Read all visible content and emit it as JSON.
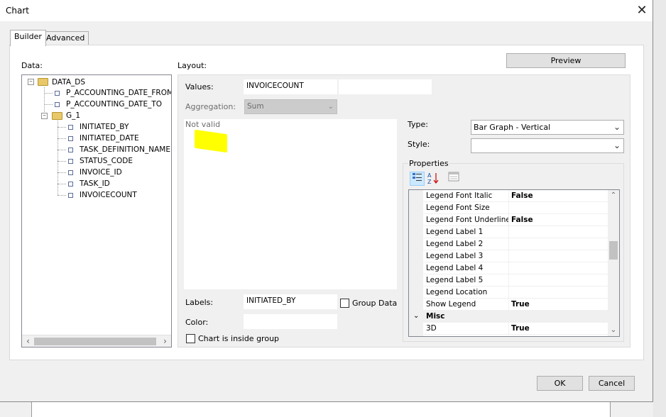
{
  "window": {
    "title": "Chart",
    "close_icon": "close-icon"
  },
  "tabs": [
    {
      "label": "Builder"
    },
    {
      "label": "Advanced"
    }
  ],
  "data_section": {
    "label": "Data:",
    "tree": {
      "root": "DATA_DS",
      "params": [
        "P_ACCOUNTING_DATE_FROM",
        "P_ACCOUNTING_DATE_TO"
      ],
      "group": "G_1",
      "fields": [
        "INITIATED_BY",
        "INITIATED_DATE",
        "TASK_DEFINITION_NAME",
        "STATUS_CODE",
        "INVOICE_ID",
        "TASK_ID",
        "INVOICECOUNT"
      ]
    }
  },
  "layout": {
    "label": "Layout:",
    "values_label": "Values:",
    "values_value": "INVOICECOUNT",
    "aggregation_label": "Aggregation:",
    "aggregation_value": "Sum",
    "preview_text": "Not valid",
    "labels_label": "Labels:",
    "labels_value": "INITIATED_BY",
    "group_data_label": "Group Data",
    "color_label": "Color:",
    "color_value": "",
    "chart_inside_group_label": "Chart is inside group"
  },
  "preview_button": "Preview",
  "type": {
    "label": "Type:",
    "value": "Bar Graph - Vertical"
  },
  "style": {
    "label": "Style:",
    "value": ""
  },
  "properties": {
    "label": "Properties",
    "rows": [
      {
        "name": "Legend Font Italic",
        "value": "False"
      },
      {
        "name": "Legend Font Size",
        "value": ""
      },
      {
        "name": "Legend Font Underline",
        "value": "False"
      },
      {
        "name": "Legend Label 1",
        "value": ""
      },
      {
        "name": "Legend Label 2",
        "value": ""
      },
      {
        "name": "Legend Label 3",
        "value": ""
      },
      {
        "name": "Legend Label 4",
        "value": ""
      },
      {
        "name": "Legend Label 5",
        "value": ""
      },
      {
        "name": "Legend Location",
        "value": ""
      },
      {
        "name": "Show Legend",
        "value": "True"
      }
    ],
    "category": "Misc",
    "misc_rows": [
      {
        "name": "3D",
        "value": "True"
      }
    ]
  },
  "footer": {
    "ok": "OK",
    "cancel": "Cancel"
  }
}
